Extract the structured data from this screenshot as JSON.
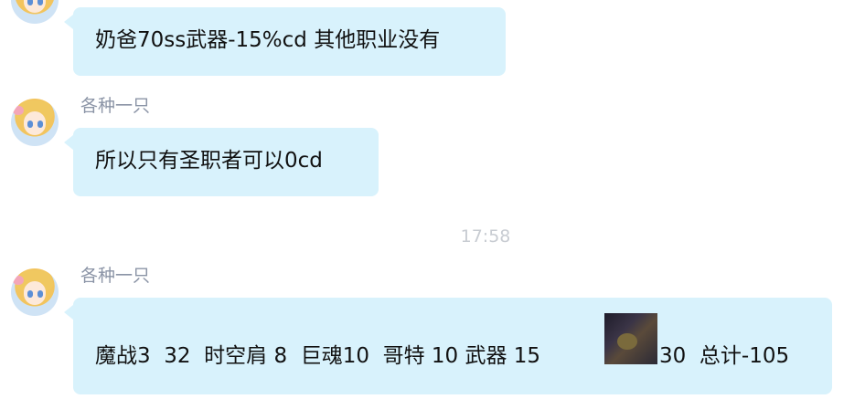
{
  "messages": [
    {
      "sender": "",
      "text": "奶爸70ss武器-15%cd 其他职业没有"
    },
    {
      "sender": "各种一只",
      "text": "所以只有圣职者可以0cd"
    },
    {
      "timestamp": "17:58"
    },
    {
      "sender": "各种一只",
      "text_before": "魔战3  32  时空肩 8  巨魂10  哥特 10 武器 15",
      "text_after": "30  总计-105",
      "image": "game-screenshot-thumbnail"
    }
  ],
  "colors": {
    "bubble": "#d8f2fc",
    "sender": "#8b94a6",
    "timestamp": "#c8ccd2"
  }
}
